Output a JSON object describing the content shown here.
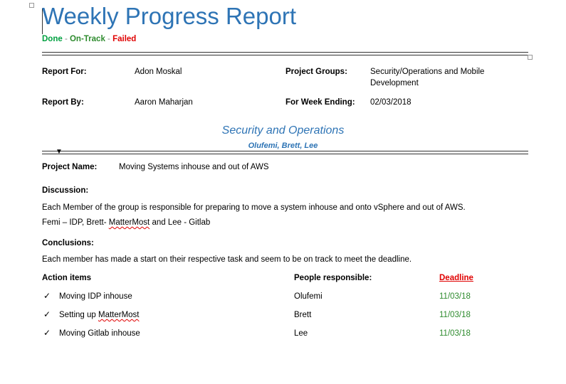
{
  "header": {
    "title": "Weekly Progress Report",
    "legend": {
      "done": "Done",
      "sep1": " - ",
      "ontrack": "On-Track",
      "sep2": " - ",
      "failed": "Failed"
    }
  },
  "meta": {
    "report_for_label": "Report For:",
    "report_for_value": "Adon Moskal",
    "project_groups_label": "Project Groups:",
    "project_groups_value": "Security/Operations and Mobile Development",
    "report_by_label": "Report By:",
    "report_by_value": "Aaron Maharjan",
    "week_ending_label": "For Week Ending:",
    "week_ending_value": "02/03/2018"
  },
  "section": {
    "title": "Security and Operations",
    "members": "Olufemi, Brett, Lee",
    "project_name_label": "Project Name:",
    "project_name_value": "Moving Systems inhouse and out of AWS",
    "discussion_label": "Discussion:",
    "discussion_line1": "Each Member of the group is responsible for preparing to move a system inhouse and onto vSphere and out of AWS.",
    "discussion_line2_a": "Femi – IDP, Brett- ",
    "discussion_line2_b": "MatterMost",
    "discussion_line2_c": " and Lee - Gitlab",
    "conclusions_label": "Conclusions:",
    "conclusions_text": "Each member has made a start on their respective task and seem to be on track to meet the deadline."
  },
  "actions": {
    "header_item": "Action items",
    "header_people": "People responsible:",
    "header_deadline": "Deadline",
    "check_glyph": "✓",
    "rows": [
      {
        "item": "Moving IDP inhouse",
        "person": "Olufemi",
        "deadline": "11/03/18"
      },
      {
        "item_a": "Setting up ",
        "item_b": "MatterMost",
        "person": "Brett",
        "deadline": "11/03/18"
      },
      {
        "item": "Moving Gitlab inhouse",
        "person": "Lee",
        "deadline": "11/03/18"
      }
    ]
  },
  "colors": {
    "title_blue": "#2e74b5",
    "done_green": "#00a040",
    "ontrack_green": "#2e8b2e",
    "failed_red": "#e00000"
  }
}
